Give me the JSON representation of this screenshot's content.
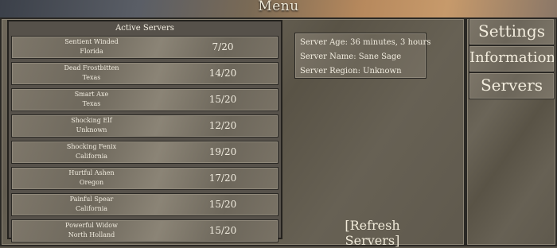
{
  "menu": {
    "title": "Menu"
  },
  "server_list": {
    "header": "Active Servers",
    "rows": [
      {
        "name": "Sentient Winded",
        "region": "Florida",
        "count": "7/20"
      },
      {
        "name": "Dead Frostbitten",
        "region": "Texas",
        "count": "14/20"
      },
      {
        "name": "Smart Axe",
        "region": "Texas",
        "count": "15/20"
      },
      {
        "name": "Shocking Elf",
        "region": "Unknown",
        "count": "12/20"
      },
      {
        "name": "Shocking Fenix",
        "region": "California",
        "count": "19/20"
      },
      {
        "name": "Hurtful Ashen",
        "region": "Oregon",
        "count": "17/20"
      },
      {
        "name": "Painful Spear",
        "region": "California",
        "count": "15/20"
      },
      {
        "name": "Powerful Widow",
        "region": "North Holland",
        "count": "15/20"
      }
    ]
  },
  "server_info": {
    "age": "Server Age: 36 minutes, 3 hours",
    "name": "Server Name: Sane Sage",
    "region": "Server Region: Unknown"
  },
  "actions": {
    "refresh_label": "[Refresh Servers]"
  },
  "sidebar": {
    "settings_label": "Settings",
    "information_label": "Information",
    "servers_label": "Servers"
  }
}
